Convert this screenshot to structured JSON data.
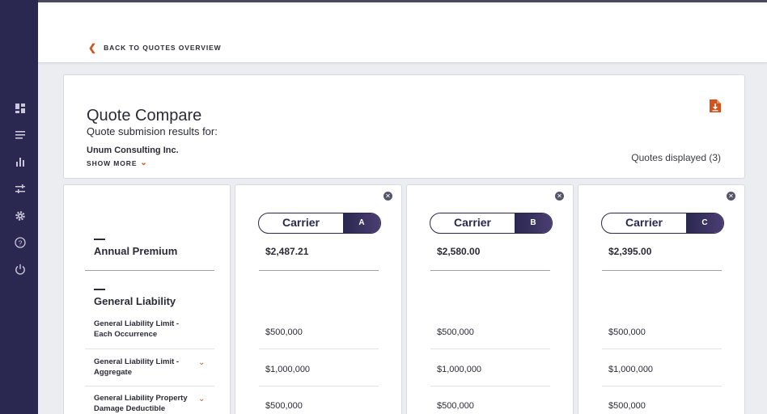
{
  "nav": {
    "back_label": "BACK TO QUOTES OVERVIEW",
    "sidebar_icons": [
      "dashboard-icon",
      "list-icon",
      "bar-chart-icon",
      "sliders-icon",
      "gear-icon",
      "help-icon",
      "power-icon"
    ]
  },
  "summary": {
    "title": "Quote Compare",
    "subtitle": "Quote submision results for:",
    "company": "Unum Consulting Inc.",
    "show_more": "SHOW MORE",
    "quotes_displayed": "Quotes displayed (3)",
    "download_icon": "pdf-download-icon"
  },
  "rows": {
    "annual_premium": "Annual Premium",
    "general_liability": "General Liability",
    "coverages": [
      "General Liability Limit - Each Occurrence",
      "General Liability Limit - Aggregate",
      "General Liability Property Damage Deductible"
    ]
  },
  "carriers": [
    {
      "name": "Carrier",
      "letter": "A",
      "premium": "$2,487.21",
      "values": [
        "$500,000",
        "$1,000,000",
        "$500,000"
      ]
    },
    {
      "name": "Carrier",
      "letter": "B",
      "premium": "$2,580.00",
      "values": [
        "$500,000",
        "$1,000,000",
        "$500,000"
      ]
    },
    {
      "name": "Carrier",
      "letter": "C",
      "premium": "$2,395.00",
      "values": [
        "$500,000",
        "$1,000,000",
        "$500,000"
      ]
    }
  ],
  "colors": {
    "sidebar": "#2a2850",
    "accent": "#d0541b"
  }
}
